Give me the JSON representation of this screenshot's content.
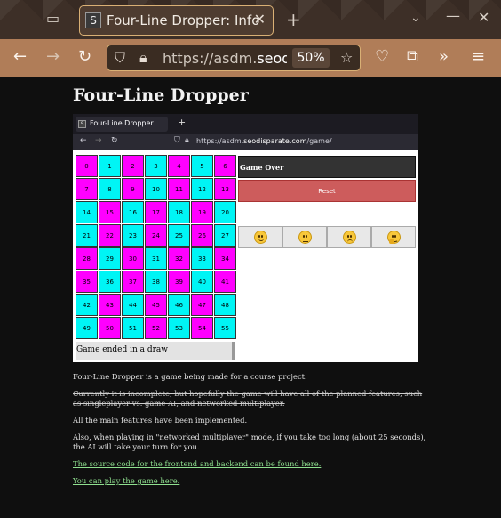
{
  "browser": {
    "tab_favicon": "S",
    "tab_title": "Four-Line Dropper: Info",
    "url_prefix": "https://asdm.",
    "url_domain": "seodisp",
    "zoom": "50%"
  },
  "page": {
    "title": "Four-Line Dropper",
    "screenshot": {
      "tab_favicon": "S",
      "tab_title": "Four-Line Dropper",
      "url_prefix": "https://asdm.",
      "url_domain": "seodisparate.com",
      "url_path": "/game/",
      "board": [
        [
          "0",
          "1",
          "2",
          "3",
          "4",
          "5",
          "6"
        ],
        [
          "7",
          "8",
          "9",
          "10",
          "11",
          "12",
          "13"
        ],
        [
          "14",
          "15",
          "16",
          "17",
          "18",
          "19",
          "20"
        ],
        [
          "21",
          "22",
          "23",
          "24",
          "25",
          "26",
          "27"
        ],
        [
          "28",
          "29",
          "30",
          "31",
          "32",
          "33",
          "34"
        ],
        [
          "35",
          "36",
          "37",
          "38",
          "39",
          "40",
          "41"
        ],
        [
          "42",
          "43",
          "44",
          "45",
          "46",
          "47",
          "48"
        ],
        [
          "49",
          "50",
          "51",
          "52",
          "53",
          "54",
          "55"
        ]
      ],
      "cell_colors": [
        [
          "mg",
          "cy",
          "mg",
          "cy",
          "mg",
          "cy",
          "mg"
        ],
        [
          "mg",
          "cy",
          "mg",
          "cy",
          "mg",
          "cy",
          "mg"
        ],
        [
          "cy",
          "mg",
          "cy",
          "mg",
          "cy",
          "mg",
          "cy"
        ],
        [
          "cy",
          "mg",
          "cy",
          "mg",
          "cy",
          "mg",
          "cy"
        ],
        [
          "mg",
          "cy",
          "mg",
          "cy",
          "mg",
          "cy",
          "mg"
        ],
        [
          "mg",
          "cy",
          "mg",
          "cy",
          "mg",
          "cy",
          "mg"
        ],
        [
          "cy",
          "mg",
          "cy",
          "mg",
          "cy",
          "mg",
          "cy"
        ],
        [
          "cy",
          "mg",
          "cy",
          "mg",
          "cy",
          "mg",
          "cy"
        ]
      ],
      "colors": {
        "cyan": "#00f5f5",
        "magenta": "#ff00ff",
        "reset": "#cd5c5c"
      },
      "status": "Game Over",
      "reset_label": "Reset",
      "emoji_buttons": [
        "smile-icon",
        "neutral-face-icon",
        "frown-icon",
        "thinking-face-icon"
      ],
      "message": "Game ended in a draw"
    },
    "para1": "Four-Line Dropper is a game being made for a course project.",
    "para2": "Currently it is incomplete, but hopefully the game will have all of the planned features, such as singleplayer vs. game AI, and networked multiplayer.",
    "para3": "All the main features have been implemented.",
    "para4": "Also, when playing in \"networked multiplayer\" mode, if you take too long (about 25 seconds), the AI will take your turn for you.",
    "link1": "The source code for the frontend and backend can be found here.",
    "link2": "You can play the game here."
  }
}
